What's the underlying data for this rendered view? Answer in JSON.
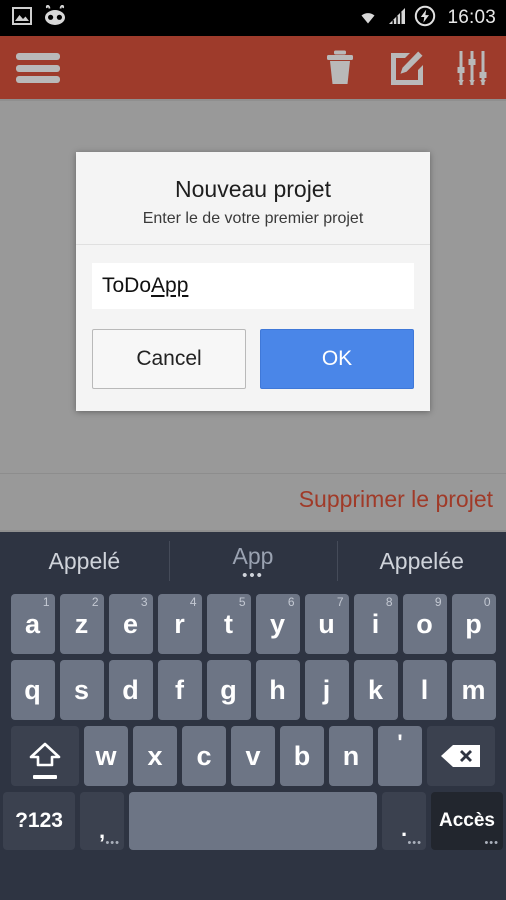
{
  "statusbar": {
    "left_icons": [
      "image-icon",
      "cyanogenmod-icon"
    ],
    "right_icons": [
      "wifi-icon",
      "signal-icon",
      "battery-charging-icon"
    ],
    "clock": "16:03"
  },
  "actionbar": {
    "menu_icon": "hamburger-menu-icon",
    "background_color": "#9e3b2b",
    "actions": [
      {
        "name": "delete-icon",
        "label": "Delete"
      },
      {
        "name": "edit-icon",
        "label": "Edit"
      },
      {
        "name": "sliders-icon",
        "label": "Settings"
      }
    ]
  },
  "content": {
    "background_color": "#999999",
    "delete_project_link": "Supprimer le projet",
    "delete_project_color": "#a03a28"
  },
  "dialog": {
    "title": "Nouveau projet",
    "subtitle": "Enter le de votre premier projet",
    "input": {
      "value_prefix": "ToDo ",
      "value_composing": "App",
      "full_value": "ToDo App",
      "placeholder": ""
    },
    "buttons": {
      "cancel": "Cancel",
      "ok": "OK",
      "ok_color": "#4a86e8"
    }
  },
  "keyboard": {
    "background_color": "#2e3442",
    "suggestions": [
      {
        "text": "Appelé",
        "active": false,
        "dots": ""
      },
      {
        "text": "App",
        "active": true,
        "dots": "•••"
      },
      {
        "text": "Appelée",
        "active": false,
        "dots": ""
      }
    ],
    "row1": [
      {
        "label": "a",
        "hint": "1"
      },
      {
        "label": "z",
        "hint": "2"
      },
      {
        "label": "e",
        "hint": "3"
      },
      {
        "label": "r",
        "hint": "4"
      },
      {
        "label": "t",
        "hint": "5"
      },
      {
        "label": "y",
        "hint": "6"
      },
      {
        "label": "u",
        "hint": "7"
      },
      {
        "label": "i",
        "hint": "8"
      },
      {
        "label": "o",
        "hint": "9"
      },
      {
        "label": "p",
        "hint": "0"
      }
    ],
    "row2": [
      {
        "label": "q"
      },
      {
        "label": "s"
      },
      {
        "label": "d"
      },
      {
        "label": "f"
      },
      {
        "label": "g"
      },
      {
        "label": "h"
      },
      {
        "label": "j"
      },
      {
        "label": "k"
      },
      {
        "label": "l"
      },
      {
        "label": "m"
      }
    ],
    "row3_letters": [
      {
        "label": "w"
      },
      {
        "label": "x"
      },
      {
        "label": "c"
      },
      {
        "label": "v"
      },
      {
        "label": "b"
      },
      {
        "label": "n"
      }
    ],
    "row3_shift": {
      "name": "shift-key",
      "label": ""
    },
    "row3_apostrophe": {
      "label": "'"
    },
    "row3_backspace": {
      "name": "backspace-key",
      "label": ""
    },
    "row4": {
      "symbols": "?123",
      "comma": ",",
      "comma_dots": "•••",
      "space": "",
      "period": ".",
      "period_dots": "•••",
      "access": "Accès",
      "access_dots": "•••"
    }
  }
}
